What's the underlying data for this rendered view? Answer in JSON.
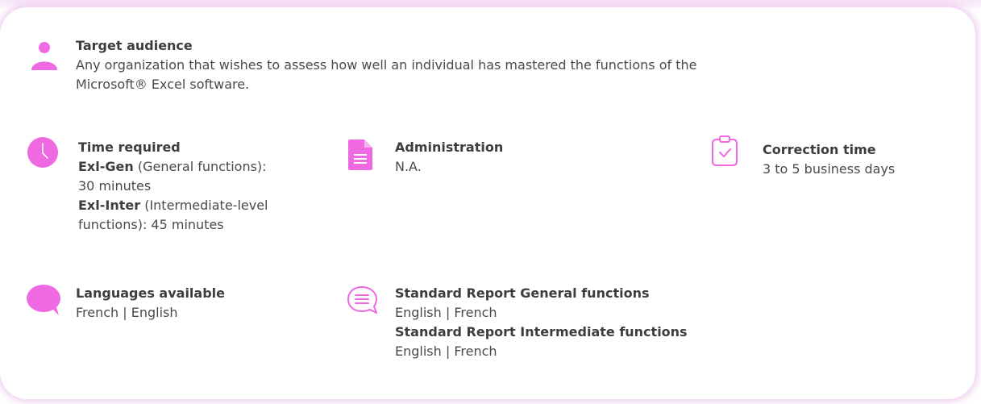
{
  "accent_color": "#ef69e2",
  "target_audience": {
    "icon": "user-icon",
    "label": "Target audience",
    "line1": "Any organization that wishes to assess how well an individual has mastered the functions of the",
    "line2": "Microsoft® Excel software."
  },
  "time_required": {
    "icon": "clock-icon",
    "label": "Time required",
    "gen_name": "Exl-Gen",
    "gen_desc": " (General functions):",
    "gen_time": "30 minutes",
    "inter_name": "Exl-Inter",
    "inter_desc": " (Intermediate-level",
    "inter_time": "functions): 45 minutes"
  },
  "administration": {
    "icon": "document-icon",
    "label": "Administration",
    "value": "N.A."
  },
  "correction_time": {
    "icon": "clipboard-check-icon",
    "label": "Correction time",
    "value": "3 to 5 business days"
  },
  "languages": {
    "icon": "speech-bubble-icon",
    "label": "Languages available",
    "value": "French | English"
  },
  "standard_report": {
    "icon": "chat-lines-icon",
    "general_label": "Standard Report General functions",
    "general_value": "English | French",
    "intermediate_label": "Standard Report Intermediate functions",
    "intermediate_value": "English | French"
  }
}
